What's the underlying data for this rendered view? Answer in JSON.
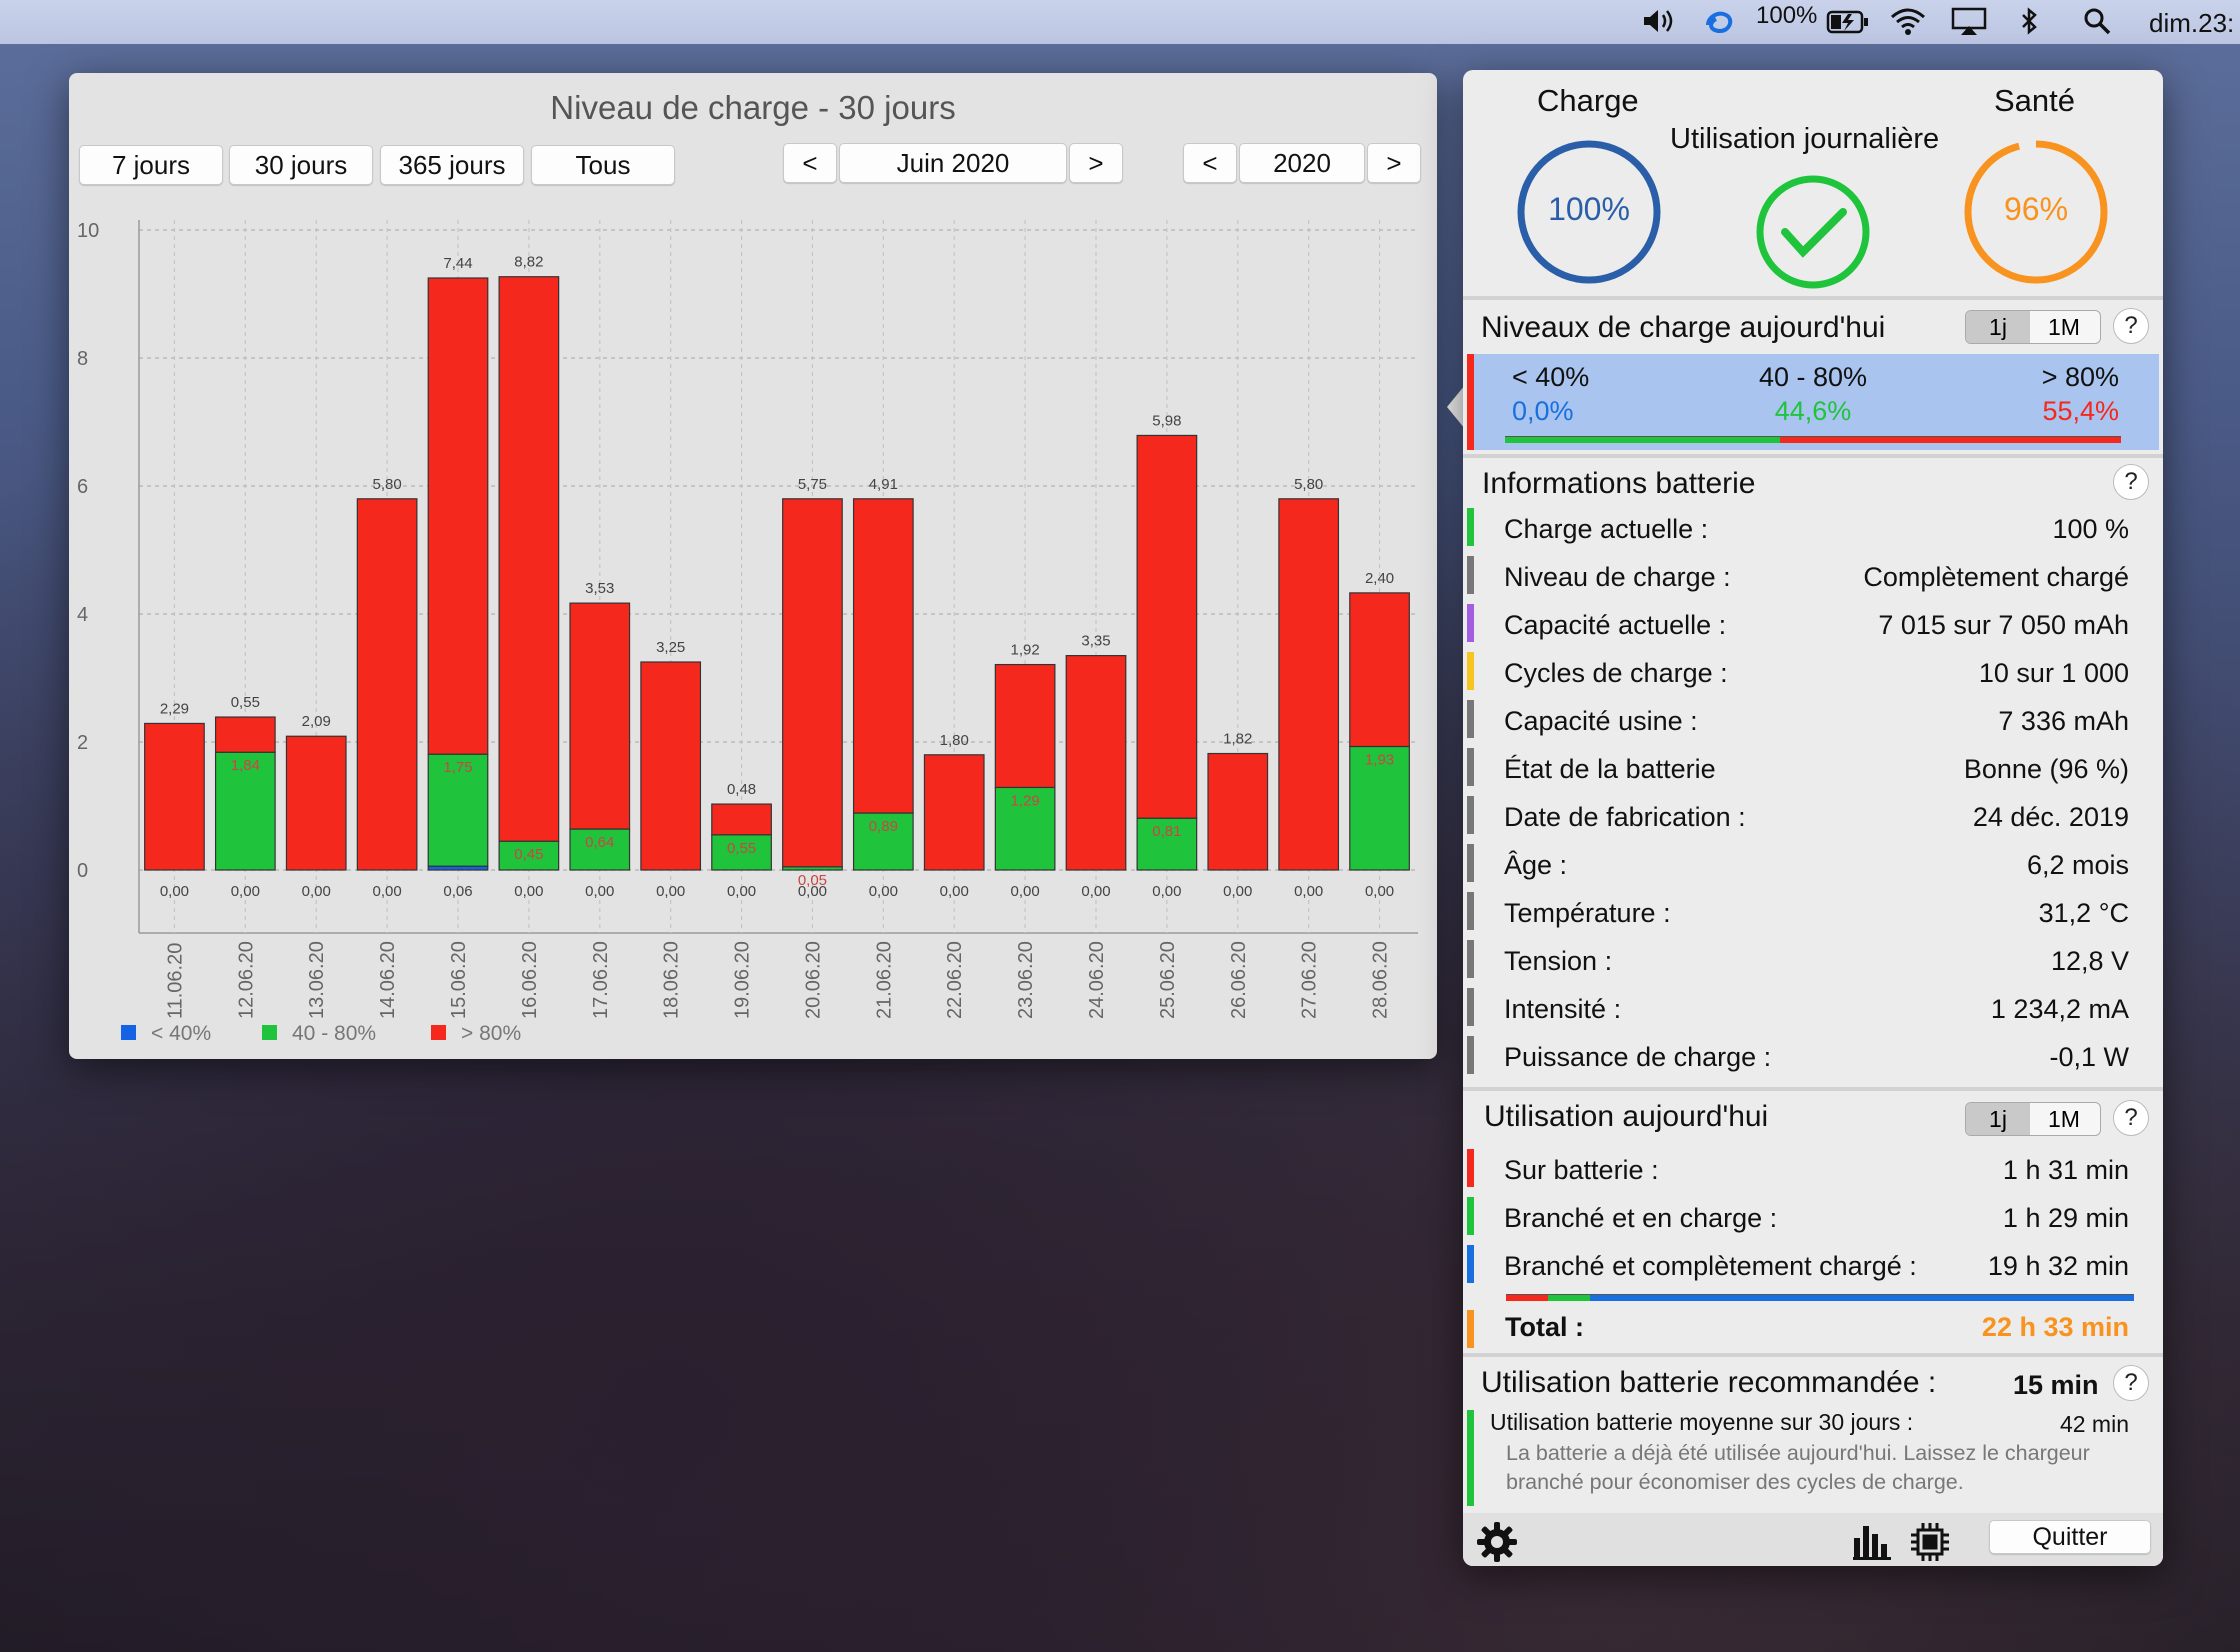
{
  "menubar": {
    "battery_percent": "100%",
    "clock": "dim.23:"
  },
  "chart_window": {
    "title": "Niveau de charge - 30 jours",
    "range_buttons": [
      "7 jours",
      "30 jours",
      "365 jours",
      "Tous"
    ],
    "month_prev": "<",
    "month_label": "Juin 2020",
    "month_next": ">",
    "year_prev": "<",
    "year_label": "2020",
    "year_next": ">"
  },
  "chart_data": {
    "type": "bar",
    "stacked": true,
    "ylim": [
      0,
      10
    ],
    "yticks": [
      "0",
      "2",
      "4",
      "6",
      "8",
      "10"
    ],
    "grid": true,
    "legend_position": "bottom-left",
    "categories": [
      "11.06.20",
      "12.06.20",
      "13.06.20",
      "14.06.20",
      "15.06.20",
      "16.06.20",
      "17.06.20",
      "18.06.20",
      "19.06.20",
      "20.06.20",
      "21.06.20",
      "22.06.20",
      "23.06.20",
      "24.06.20",
      "25.06.20",
      "26.06.20",
      "27.06.20",
      "28.06.20"
    ],
    "series": [
      {
        "name": "< 40%",
        "color": "#1463e6",
        "values": [
          0,
          0,
          0,
          0,
          0.06,
          0,
          0,
          0,
          0,
          0,
          0,
          0,
          0,
          0,
          0,
          0,
          0,
          0
        ]
      },
      {
        "name": "40 - 80%",
        "color": "#1fc43c",
        "values": [
          0,
          1.84,
          0,
          0,
          1.75,
          0.45,
          0.64,
          0,
          0.55,
          0.05,
          0.89,
          0,
          1.29,
          0,
          0.81,
          0,
          0,
          1.93
        ]
      },
      {
        "name": "> 80%",
        "color": "#f5281e",
        "values": [
          2.29,
          0.55,
          2.09,
          5.8,
          7.44,
          8.82,
          3.53,
          3.25,
          0.48,
          5.75,
          4.91,
          1.8,
          1.92,
          3.35,
          5.98,
          1.82,
          5.8,
          2.4
        ]
      }
    ],
    "bottom_labels": [
      "0,00",
      "0,00",
      "0,00",
      "0,00",
      "0,06",
      "0,00",
      "0,00",
      "0,00",
      "0,00",
      "0,00",
      "0,00",
      "0,00",
      "0,00",
      "0,00",
      "0,00",
      "0,00",
      "0,00",
      "0,00"
    ],
    "green_labels": [
      "",
      "1,84",
      "",
      "",
      "1,75",
      "0,45",
      "0,64",
      "",
      "0,55",
      "0,05",
      "0,89",
      "",
      "1,29",
      "",
      "0,81",
      "",
      "",
      "1,93"
    ],
    "red_labels": [
      "2,29",
      "0,55",
      "2,09",
      "5,80",
      "7,44",
      "8,82",
      "3,53",
      "3,25",
      "0,48",
      "5,75",
      "4,91",
      "1,80",
      "1,92",
      "3,35",
      "5,98",
      "1,82",
      "5,80",
      "2,40"
    ]
  },
  "popover": {
    "charge_label": "Charge",
    "charge_value": "100%",
    "daily_label": "Utilisation journalière",
    "health_label": "Santé",
    "health_value": "96%",
    "levels": {
      "title": "Niveaux de charge aujourd'hui",
      "seg_1j": "1j",
      "seg_1m": "1M",
      "help": "?",
      "cols": [
        {
          "label": "< 40%",
          "value": "0,0%",
          "color": "#1a6fe0"
        },
        {
          "label": "40 - 80%",
          "value": "44,6%",
          "color": "#1fc43c"
        },
        {
          "label": "> 80%",
          "value": "55,4%",
          "color": "#f5281e"
        }
      ],
      "fractions": [
        0.0,
        0.446,
        0.554
      ]
    },
    "info": {
      "title": "Informations batterie",
      "help": "?",
      "rows": [
        {
          "label": "Charge actuelle :",
          "value": "100 %",
          "color": "#23c33d"
        },
        {
          "label": "Niveau de charge :",
          "value": "Complètement chargé",
          "color": "#777777"
        },
        {
          "label": "Capacité actuelle :",
          "value": "7 015 sur 7 050 mAh",
          "color": "#a25ee0"
        },
        {
          "label": "Cycles de charge :",
          "value": "10 sur 1 000",
          "color": "#f7c520"
        },
        {
          "label": "Capacité usine :",
          "value": "7 336 mAh",
          "color": "#777777"
        },
        {
          "label": "État de la batterie",
          "value": "Bonne (96 %)",
          "color": "#777777"
        },
        {
          "label": "Date de fabrication :",
          "value": "24 déc. 2019",
          "color": "#777777"
        },
        {
          "label": "Âge :",
          "value": "6,2 mois",
          "color": "#777777"
        },
        {
          "label": "Température :",
          "value": "31,2 °C",
          "color": "#777777"
        },
        {
          "label": "Tension :",
          "value": "12,8 V",
          "color": "#777777"
        },
        {
          "label": "Intensité :",
          "value": "1 234,2 mA",
          "color": "#777777"
        },
        {
          "label": "Puissance de charge :",
          "value": "-0,1 W",
          "color": "#777777"
        }
      ]
    },
    "usage": {
      "title": "Utilisation aujourd'hui",
      "seg_1j": "1j",
      "seg_1m": "1M",
      "help": "?",
      "rows": [
        {
          "label": "Sur batterie :",
          "value": "1 h 31 min",
          "color": "#f5281e"
        },
        {
          "label": "Branché et en charge :",
          "value": "1 h 29 min",
          "color": "#1fc43c"
        },
        {
          "label": "Branché et complètement chargé :",
          "value": "19 h 32 min",
          "color": "#1a6fe0"
        }
      ],
      "fractions": [
        0.067,
        0.066,
        0.867
      ],
      "total_label": "Total :",
      "total_value": "22 h 33 min",
      "total_color": "#f7931e"
    },
    "recommended": {
      "title": "Utilisation batterie recommandée :",
      "value": "15 min",
      "help": "?",
      "avg_label": "Utilisation batterie moyenne sur 30 jours :",
      "avg_value": "42 min",
      "note": "La batterie a déjà été utilisée aujourd'hui. Laissez le chargeur branché pour économiser des cycles de charge."
    },
    "quit_label": "Quitter"
  }
}
